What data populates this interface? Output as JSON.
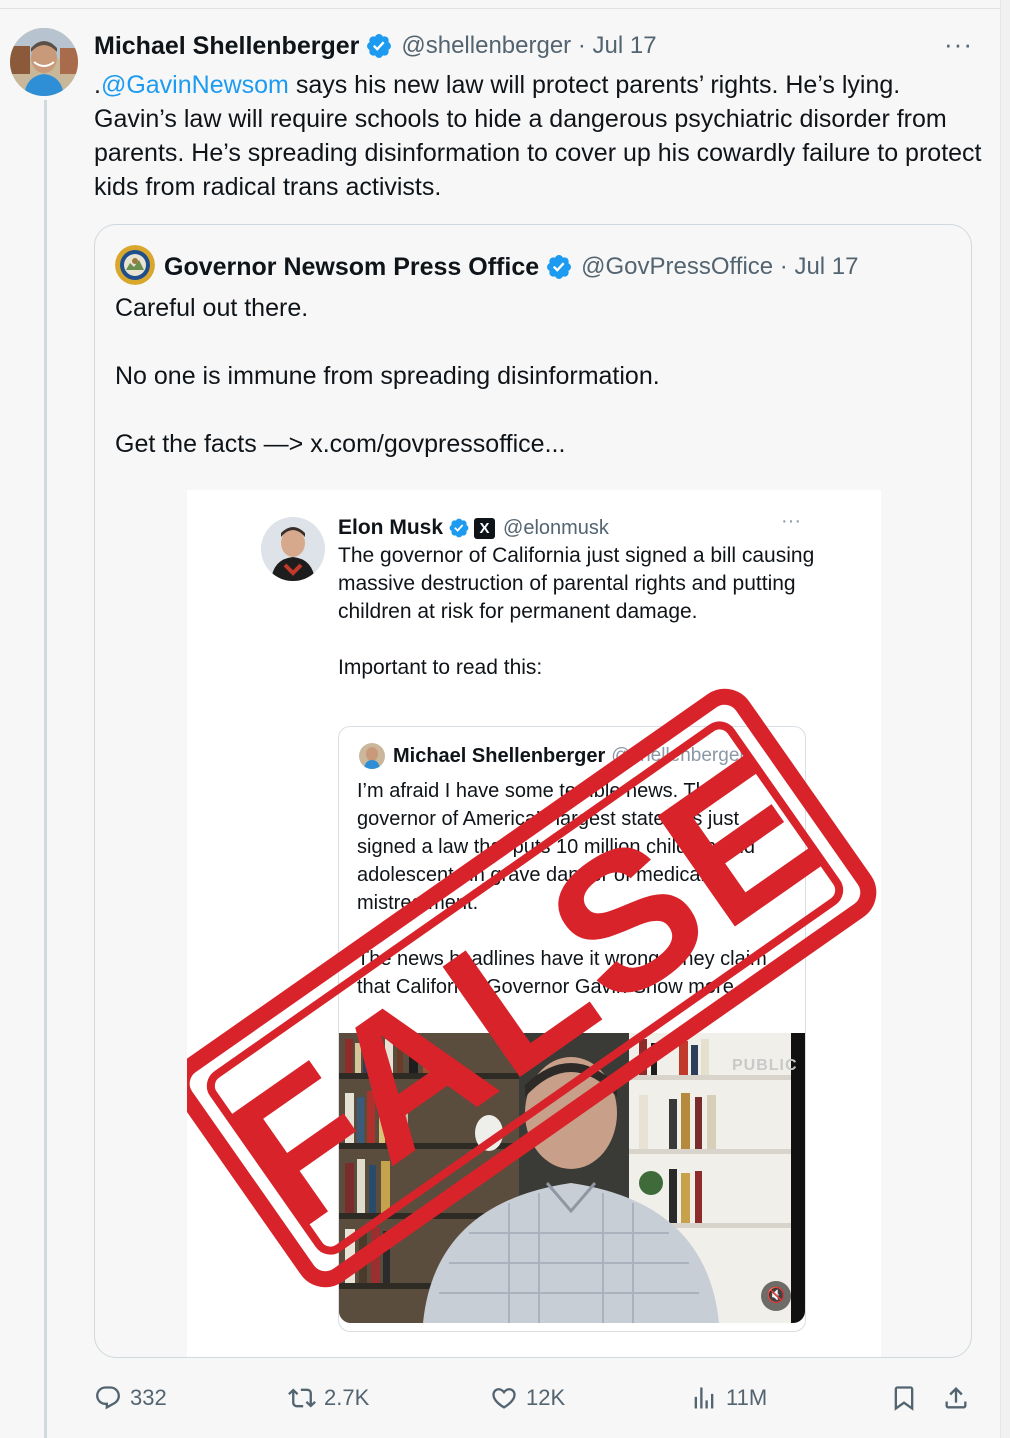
{
  "tweet": {
    "author_name": "Michael Shellenberger",
    "handle_meta": "@shellenberger · Jul 17",
    "mention": "@GavinNewsom",
    "text_prefix": ".",
    "text_body": " says his new law will protect parents’ rights. He’s lying. Gavin’s law will require schools to hide a dangerous psychiatric disorder from parents. He’s spreading disinformation to cover up his cowardly failure to protect kids from radical trans activists.",
    "more_label": "···"
  },
  "quote": {
    "author_name": "Governor Newsom Press Office",
    "handle_meta": "@GovPressOffice · Jul 17",
    "lines": [
      "Careful out there.",
      "No one is immune from spreading disinformation.",
      "Get the facts —> x.com/govpressoffice..."
    ]
  },
  "media": {
    "author_name": "Elon Musk",
    "x_badge": "X",
    "handle": "@elonmusk",
    "more_label": "···",
    "text": "The governor of California just signed a bill causing massive destruction of parental rights and putting children at risk for permanent damage.",
    "text2": "Important to read this:",
    "inner": {
      "author_name": "Michael Shellenberger",
      "handle": "@shellenberger",
      "text": "I’m afraid I have some terrible news. The governor of America’s largest state has just signed a law that puts 10 million children and adolescents in grave danger of medical mistreatment.",
      "text2": "The news headlines have it wrong. They claim that California Governor Gavin Show more",
      "video_label": "PUBLIC"
    },
    "stamp_text": "FALSE",
    "stamp_color": "#d8232a"
  },
  "actions": {
    "replies": "332",
    "reposts": "2.7K",
    "likes": "12K",
    "views": "11M"
  },
  "colors": {
    "link": "#1d9bf0",
    "secondary_text": "#536471",
    "verified": "#1d9bf0"
  }
}
